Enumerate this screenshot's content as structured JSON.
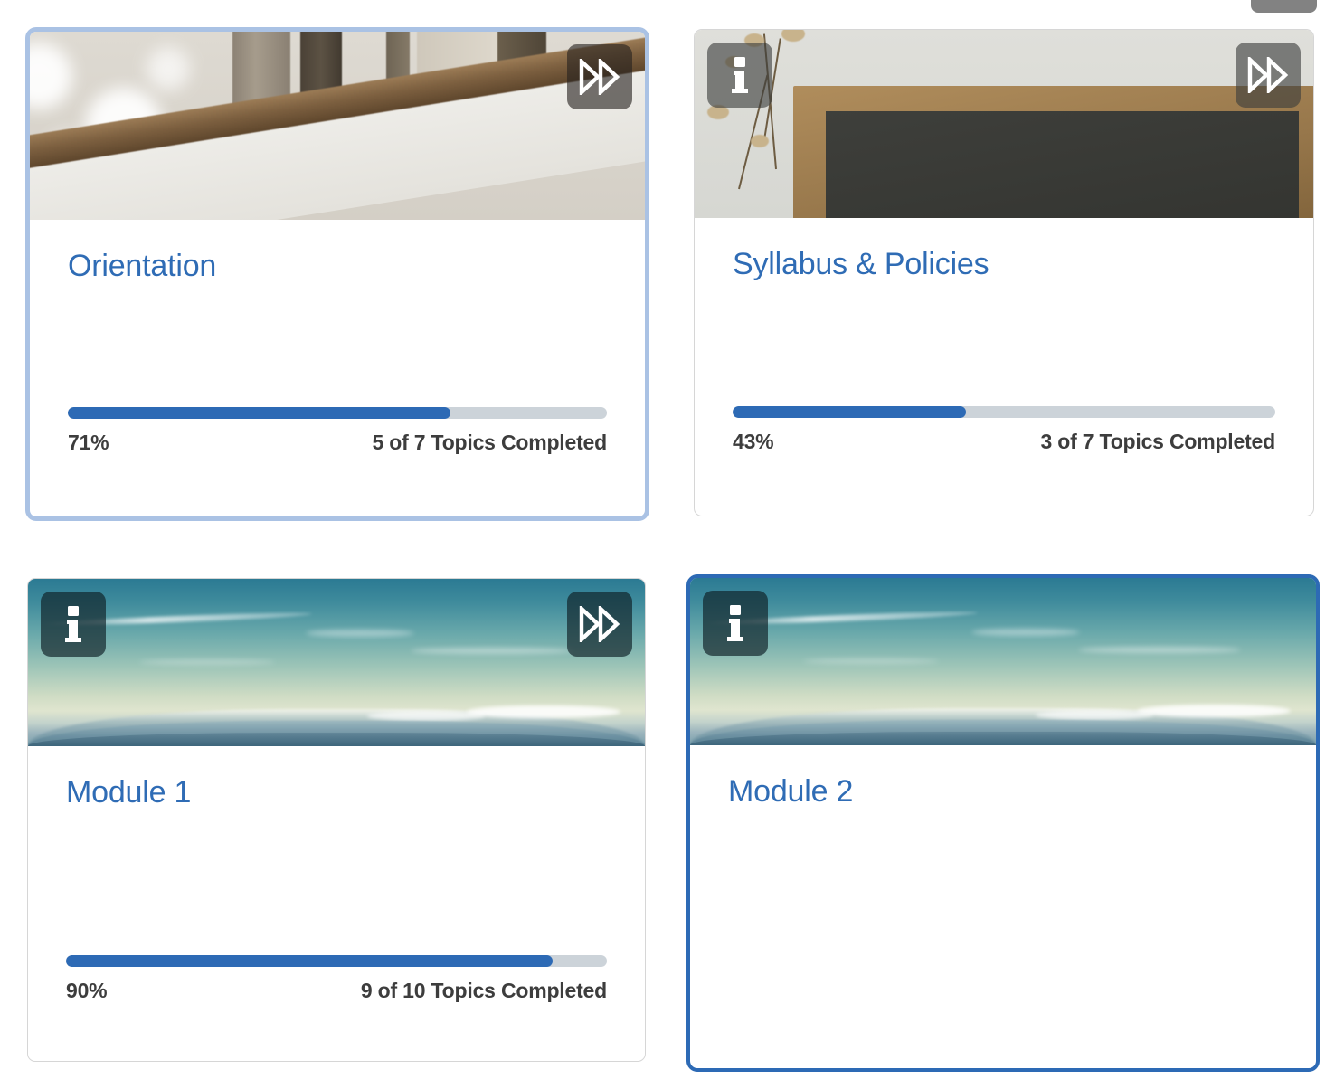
{
  "scrollbar": {
    "name": "vertical-scrollbar-thumb",
    "color": "#828282"
  },
  "theme": {
    "title_color": "#2f6cb5",
    "progress_fill_color": "#2d6ab5",
    "progress_track_color": "#ccd3d9",
    "meta_text_color": "#3d3d3d",
    "highlight_border_color": "#aac2e4",
    "focus_border_color": "#2d6ab5",
    "plain_border_color": "#d6d6d6"
  },
  "icons": {
    "info": "info-icon",
    "next": "fast-forward-icon"
  },
  "cards": [
    {
      "id": "orientation",
      "title": "Orientation",
      "percent_label": "71%",
      "percent_value": 71,
      "topics_label": "5 of 7 Topics Completed",
      "topics_completed": 5,
      "topics_total": 7,
      "state": "highlight",
      "has_info_button": false,
      "has_next_button": true,
      "has_progress": true,
      "image": "blurred-wooden-posts-and-frame"
    },
    {
      "id": "syllabus-policies",
      "title": "Syllabus & Policies",
      "percent_label": "43%",
      "percent_value": 43,
      "topics_label": "3 of 7 Topics Completed",
      "topics_completed": 3,
      "topics_total": 7,
      "state": "plain",
      "has_info_button": true,
      "has_next_button": true,
      "has_progress": true,
      "image": "chalkboard-in-wooden-frame-with-dried-flowers"
    },
    {
      "id": "module-1",
      "title": "Module 1",
      "percent_label": "90%",
      "percent_value": 90,
      "topics_label": "9 of 10 Topics Completed",
      "topics_completed": 9,
      "topics_total": 10,
      "state": "plain",
      "has_info_button": true,
      "has_next_button": true,
      "has_progress": true,
      "image": "mountain-range-under-hazy-sky"
    },
    {
      "id": "module-2",
      "title": "Module 2",
      "percent_label": "",
      "percent_value": null,
      "topics_label": "",
      "topics_completed": null,
      "topics_total": null,
      "state": "focused",
      "has_info_button": true,
      "has_next_button": false,
      "has_progress": false,
      "image": "mountain-range-under-hazy-sky"
    }
  ]
}
